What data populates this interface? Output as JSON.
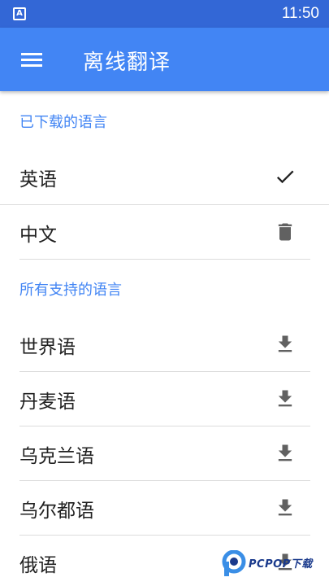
{
  "status_bar": {
    "time": "11:50",
    "app_icon_letter": "A"
  },
  "app_bar": {
    "title": "离线翻译",
    "menu_icon": "menu-icon"
  },
  "downloaded_section": {
    "header": "已下载的语言",
    "items": [
      {
        "label": "英语",
        "icon": "check-icon"
      },
      {
        "label": "中文",
        "icon": "delete-icon"
      }
    ]
  },
  "all_section": {
    "header": "所有支持的语言",
    "items": [
      {
        "label": "世界语",
        "icon": "download-icon"
      },
      {
        "label": "丹麦语",
        "icon": "download-icon"
      },
      {
        "label": "乌克兰语",
        "icon": "download-icon"
      },
      {
        "label": "乌尔都语",
        "icon": "download-icon"
      },
      {
        "label": "俄语",
        "icon": "download-icon"
      }
    ]
  },
  "watermark": {
    "text": "PCPOP下载"
  },
  "colors": {
    "status_bar": "#3367d6",
    "app_bar": "#4285f4",
    "section_header": "#4285f4",
    "icon": "#616161"
  }
}
